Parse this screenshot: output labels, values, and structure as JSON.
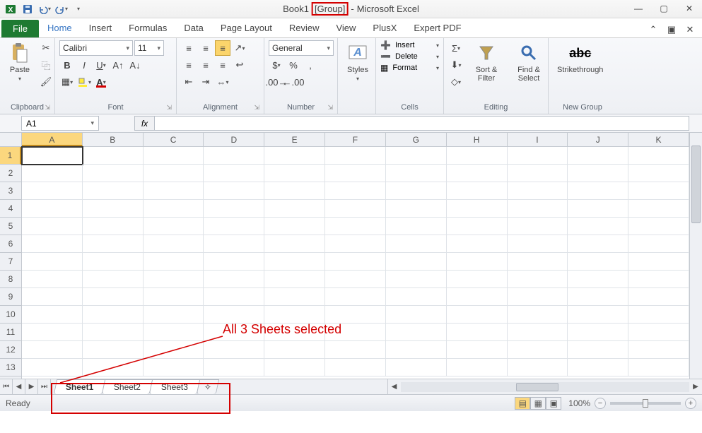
{
  "title": {
    "doc": "Book1",
    "group": "[Group]",
    "sep": "-",
    "app": "Microsoft Excel"
  },
  "qat": {
    "save": "save-icon",
    "undo": "undo-icon",
    "redo": "redo-icon"
  },
  "tabs": {
    "file": "File",
    "list": [
      "Home",
      "Insert",
      "Formulas",
      "Data",
      "Page Layout",
      "Review",
      "View",
      "PlusX",
      "Expert PDF"
    ]
  },
  "ribbon": {
    "clipboard": {
      "paste": "Paste",
      "label": "Clipboard"
    },
    "font": {
      "name": "Calibri",
      "size": "11",
      "label": "Font"
    },
    "alignment": {
      "label": "Alignment"
    },
    "number": {
      "format": "General",
      "label": "Number"
    },
    "styles": {
      "btn": "Styles"
    },
    "cells": {
      "insert": "Insert",
      "delete": "Delete",
      "format": "Format",
      "label": "Cells"
    },
    "editing": {
      "sort": "Sort & Filter",
      "find": "Find & Select",
      "label": "Editing"
    },
    "newgroup": {
      "strike": "Strikethrough",
      "label": "New Group"
    }
  },
  "formula": {
    "namebox": "A1",
    "fx": "fx"
  },
  "grid": {
    "cols": [
      "A",
      "B",
      "C",
      "D",
      "E",
      "F",
      "G",
      "H",
      "I",
      "J",
      "K"
    ],
    "rows": [
      "1",
      "2",
      "3",
      "4",
      "5",
      "6",
      "7",
      "8",
      "9",
      "10",
      "11",
      "12",
      "13"
    ],
    "selected_col": 0,
    "selected_row": 0
  },
  "sheets": {
    "tabs": [
      "Sheet1",
      "Sheet2",
      "Sheet3"
    ],
    "active": 0
  },
  "status": {
    "ready": "Ready",
    "zoom": "100%"
  },
  "annotation": {
    "text": "All 3 Sheets selected"
  }
}
